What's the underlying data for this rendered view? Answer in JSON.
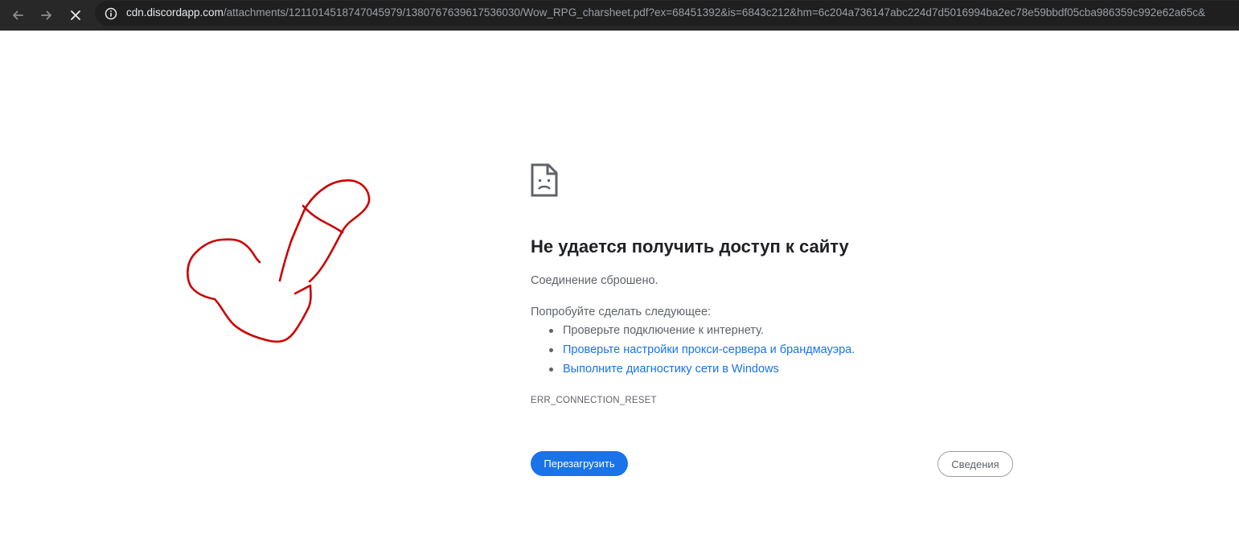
{
  "browser": {
    "url_host": "cdn.discordapp.com",
    "url_rest": "/attachments/1211014518747045979/1380767639617536030/Wow_RPG_charsheet.pdf?ex=68451392&is=6843c212&hm=6c204a736147abc224d7d5016994ba2ec78e59bbdf05cba986359c992e62a65c&",
    "nav_icons": [
      "back-arrow-icon",
      "forward-arrow-icon",
      "stop-loading-icon"
    ],
    "site_info_icon": "info-icon"
  },
  "error_page": {
    "icon": "sad-document-icon",
    "title": "Не удается получить доступ к сайту",
    "message": "Соединение сброшено.",
    "try_heading": "Попробуйте сделать следующее:",
    "suggestions": [
      {
        "text": "Проверьте подключение к интернету.",
        "link": false
      },
      {
        "text": "Проверьте настройки прокси-сервера и брандмауэра.",
        "link": true
      },
      {
        "text": "Выполните диагностику сети в Windows",
        "link": true
      }
    ],
    "error_code": "ERR_CONNECTION_RESET",
    "reload_label": "Перезагрузить",
    "details_label": "Сведения"
  },
  "colors": {
    "toolbar": "#282828",
    "link": "#1a73e8",
    "annotation": "#cc0000"
  }
}
